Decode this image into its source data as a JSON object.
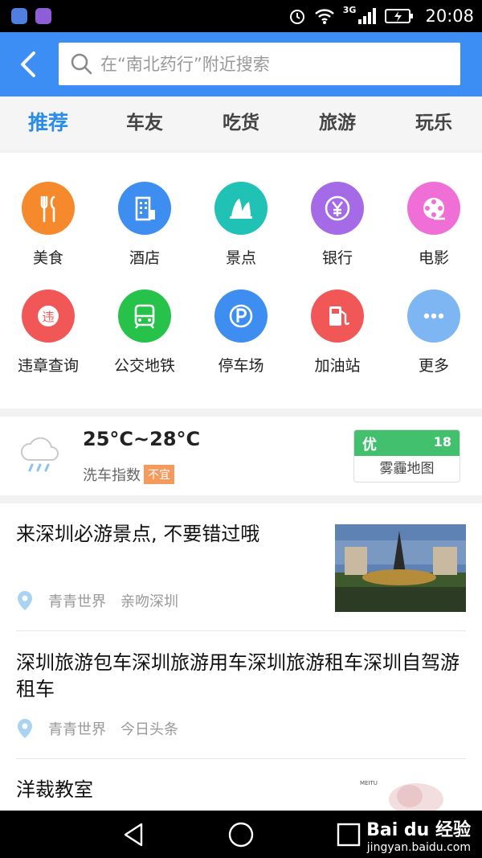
{
  "status_bar": {
    "network": "3G",
    "time": "20:08"
  },
  "search": {
    "placeholder": "在“南北药行”附近搜索"
  },
  "tabs": [
    {
      "label": "推荐",
      "active": true
    },
    {
      "label": "车友"
    },
    {
      "label": "吃货"
    },
    {
      "label": "旅游"
    },
    {
      "label": "玩乐"
    }
  ],
  "categories": [
    {
      "label": "美食",
      "icon": "fork-knife-icon",
      "color": "#f5892c"
    },
    {
      "label": "酒店",
      "icon": "building-icon",
      "color": "#3d8ef0"
    },
    {
      "label": "景点",
      "icon": "landmark-icon",
      "color": "#1fc2b4"
    },
    {
      "label": "银行",
      "icon": "yen-icon",
      "color": "#a56ae6"
    },
    {
      "label": "电影",
      "icon": "film-reel-icon",
      "color": "#f06fd6"
    },
    {
      "label": "违章查询",
      "icon": "violation-icon",
      "color": "#f25757",
      "badge": "违"
    },
    {
      "label": "公交地铁",
      "icon": "bus-icon",
      "color": "#26c24a"
    },
    {
      "label": "停车场",
      "icon": "parking-icon",
      "color": "#3d8ef0"
    },
    {
      "label": "加油站",
      "icon": "gas-station-icon",
      "color": "#f25757"
    },
    {
      "label": "更多",
      "icon": "more-icon",
      "color": "#7eb6f4"
    }
  ],
  "weather": {
    "temperature": "25°C~28°C",
    "car_wash_label": "洗车指数",
    "car_wash_value": "不宜",
    "air_quality_level": "优",
    "air_quality_value": "18",
    "haze_map_label": "雾霾地图"
  },
  "articles": [
    {
      "title": "来深圳必游景点, 不要错过哦",
      "location": "青青世界",
      "source": "亲吻深圳"
    },
    {
      "title": "深圳旅游包车深圳旅游用车深圳旅游租车深圳自驾游租车",
      "location": "青青世界",
      "source": "今日头条"
    },
    {
      "title": "洋裁教室",
      "thumb_text": "MEITU"
    }
  ],
  "watermark": {
    "logo": "Bai du 经验",
    "url": "jingyan.baidu.com"
  },
  "colors": {
    "header": "#3c8ef5",
    "active_tab": "#2b8de8",
    "aqi_good": "#42c06d",
    "wash_badge": "#f59a5c"
  }
}
